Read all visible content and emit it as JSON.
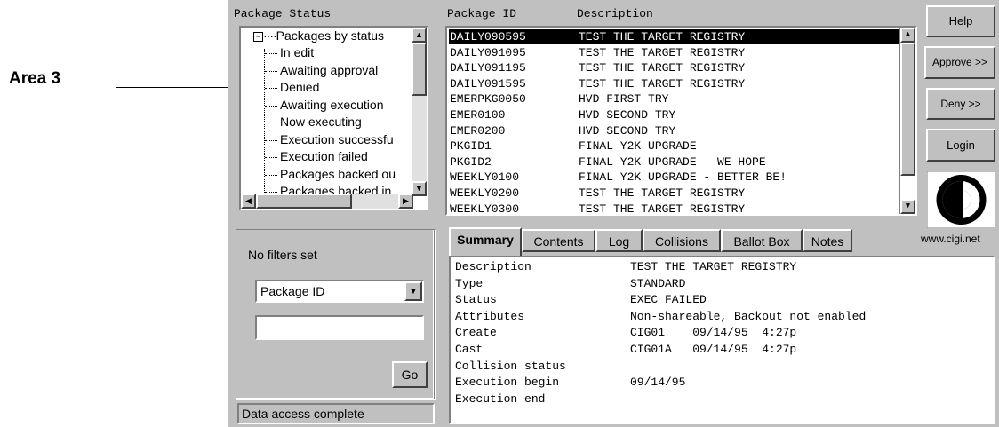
{
  "callout": {
    "label": "Area 3"
  },
  "headers": {
    "package_status": "Package Status",
    "package_id": "Package ID",
    "description": "Description"
  },
  "tree": {
    "root": "Packages by status",
    "items": [
      "In edit",
      "Awaiting approval",
      "Denied",
      "Awaiting execution",
      "Now executing",
      "Execution successfu",
      "Execution failed",
      "Packages backed ou",
      "Packages backed in"
    ]
  },
  "packages": [
    {
      "id": "DAILY090595",
      "desc": "TEST THE TARGET REGISTRY",
      "selected": true
    },
    {
      "id": "DAILY091095",
      "desc": "TEST THE TARGET REGISTRY"
    },
    {
      "id": "DAILY091195",
      "desc": "TEST THE TARGET REGISTRY"
    },
    {
      "id": "DAILY091595",
      "desc": "TEST THE TARGET REGISTRY"
    },
    {
      "id": "EMERPKG0050",
      "desc": "HVD FIRST TRY"
    },
    {
      "id": "EMER0100",
      "desc": "HVD SECOND TRY"
    },
    {
      "id": "EMER0200",
      "desc": "HVD SECOND TRY"
    },
    {
      "id": "PKGID1",
      "desc": "FINAL Y2K UPGRADE"
    },
    {
      "id": "PKGID2",
      "desc": "FINAL Y2K UPGRADE - WE HOPE"
    },
    {
      "id": "WEEKLY0100",
      "desc": "FINAL Y2K UPGRADE - BETTER BE!"
    },
    {
      "id": "WEEKLY0200",
      "desc": "TEST THE TARGET REGISTRY"
    },
    {
      "id": "WEEKLY0300",
      "desc": "TEST THE TARGET REGISTRY"
    }
  ],
  "buttons": {
    "help": "Help",
    "approve": "Approve >>",
    "deny": "Deny >>",
    "login": "Login",
    "go": "Go"
  },
  "logo": {
    "url_text": "www.cigi.net"
  },
  "filter": {
    "status": "No filters set",
    "field_selected": "Package ID",
    "value": ""
  },
  "status_bar": "Data access complete",
  "tabs": [
    "Summary",
    "Contents",
    "Log",
    "Collisions",
    "Ballot Box",
    "Notes"
  ],
  "active_tab": "Summary",
  "summary": [
    {
      "label": "Description",
      "value": "TEST THE TARGET REGISTRY"
    },
    {
      "label": "Type",
      "value": "STANDARD"
    },
    {
      "label": "Status",
      "value": "EXEC FAILED"
    },
    {
      "label": "Attributes",
      "value": "Non-shareable, Backout not enabled"
    },
    {
      "label": "Create",
      "value": "CIG01    09/14/95  4:27p"
    },
    {
      "label": "Cast",
      "value": "CIG01A   09/14/95  4:27p"
    },
    {
      "label": "Collision status",
      "value": ""
    },
    {
      "label": "Execution begin",
      "value": "09/14/95"
    },
    {
      "label": "Execution end",
      "value": ""
    }
  ]
}
